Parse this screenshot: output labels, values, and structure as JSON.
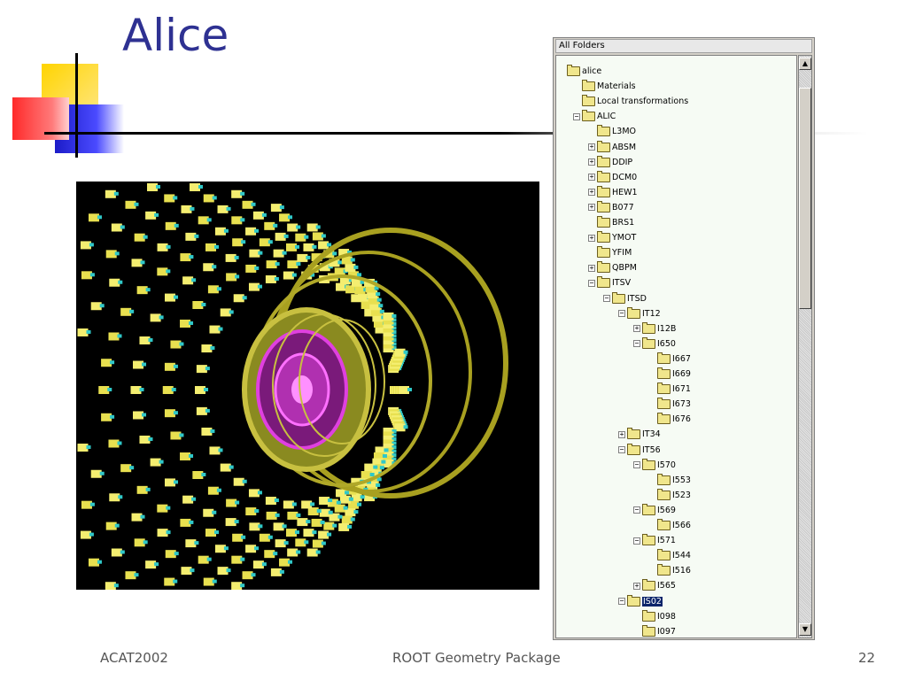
{
  "slide": {
    "title": "Alice",
    "footer_left": "ACAT2002",
    "footer_center": "ROOT Geometry Package",
    "page_number": "22"
  },
  "tree": {
    "header": "All Folders",
    "items": [
      {
        "label": "alice",
        "level": 0,
        "exp": ""
      },
      {
        "label": "Materials",
        "level": 1,
        "exp": ""
      },
      {
        "label": "Local transformations",
        "level": 1,
        "exp": ""
      },
      {
        "label": "ALIC",
        "level": 1,
        "exp": "-"
      },
      {
        "label": "L3MO",
        "level": 2,
        "exp": ""
      },
      {
        "label": "ABSM",
        "level": 2,
        "exp": "+"
      },
      {
        "label": "DDIP",
        "level": 2,
        "exp": "+"
      },
      {
        "label": "DCM0",
        "level": 2,
        "exp": "+"
      },
      {
        "label": "HEW1",
        "level": 2,
        "exp": "+"
      },
      {
        "label": "B077",
        "level": 2,
        "exp": "+"
      },
      {
        "label": "BRS1",
        "level": 2,
        "exp": ""
      },
      {
        "label": "YMOT",
        "level": 2,
        "exp": "+"
      },
      {
        "label": "YFIM",
        "level": 2,
        "exp": ""
      },
      {
        "label": "QBPM",
        "level": 2,
        "exp": "+"
      },
      {
        "label": "ITSV",
        "level": 2,
        "exp": "-"
      },
      {
        "label": "ITSD",
        "level": 3,
        "exp": "-"
      },
      {
        "label": "IT12",
        "level": 4,
        "exp": "-"
      },
      {
        "label": "I12B",
        "level": 5,
        "exp": "+"
      },
      {
        "label": "I650",
        "level": 5,
        "exp": "-"
      },
      {
        "label": "I667",
        "level": 6,
        "exp": ""
      },
      {
        "label": "I669",
        "level": 6,
        "exp": ""
      },
      {
        "label": "I671",
        "level": 6,
        "exp": ""
      },
      {
        "label": "I673",
        "level": 6,
        "exp": ""
      },
      {
        "label": "I676",
        "level": 6,
        "exp": ""
      },
      {
        "label": "IT34",
        "level": 4,
        "exp": "+"
      },
      {
        "label": "IT56",
        "level": 4,
        "exp": "-"
      },
      {
        "label": "I570",
        "level": 5,
        "exp": "-"
      },
      {
        "label": "I553",
        "level": 6,
        "exp": ""
      },
      {
        "label": "I523",
        "level": 6,
        "exp": ""
      },
      {
        "label": "I569",
        "level": 5,
        "exp": "-"
      },
      {
        "label": "I566",
        "level": 6,
        "exp": ""
      },
      {
        "label": "I571",
        "level": 5,
        "exp": "-"
      },
      {
        "label": "I544",
        "level": 6,
        "exp": ""
      },
      {
        "label": "I516",
        "level": 6,
        "exp": ""
      },
      {
        "label": "I565",
        "level": 5,
        "exp": "+"
      },
      {
        "label": "IS02",
        "level": 4,
        "exp": "-",
        "selected": true
      },
      {
        "label": "I098",
        "level": 5,
        "exp": ""
      },
      {
        "label": "I097",
        "level": 5,
        "exp": ""
      }
    ]
  },
  "colors": {
    "title": "#2e3192",
    "accent_yellow": "#ffd700",
    "accent_red": "#ff3333",
    "accent_blue": "#2222cc"
  }
}
